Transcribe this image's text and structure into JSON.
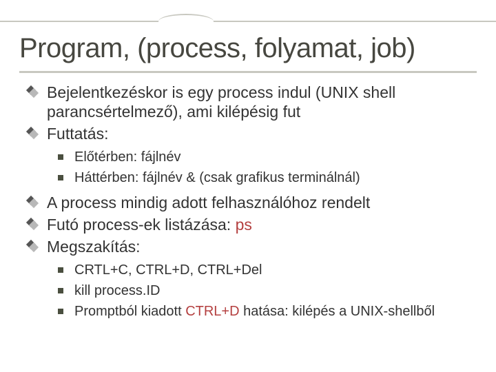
{
  "title": "Program, (process, folyamat, job)",
  "level1": {
    "item0": "Bejelentkezéskor is egy process indul (UNIX shell parancsértelmező), ami kilépésig fut",
    "item1": "Futtatás:",
    "item2": "A process mindig adott felhasználóhoz rendelt",
    "item3_pre": "Futó process-ek listázása: ",
    "item3_cmd": "ps",
    "item4": "Megszakítás:"
  },
  "sub1": {
    "a": "Előtérben: fájlnév",
    "b": "Háttérben: fájlnév &  (csak grafikus terminálnál)"
  },
  "sub2": {
    "a": "CRTL+C,  CTRL+D, CTRL+Del",
    "b": "kill process.ID",
    "c_pre": "Promptból kiadott ",
    "c_cmd": "CTRL+D",
    "c_post": " hatása: kilépés a UNIX-shellből"
  }
}
